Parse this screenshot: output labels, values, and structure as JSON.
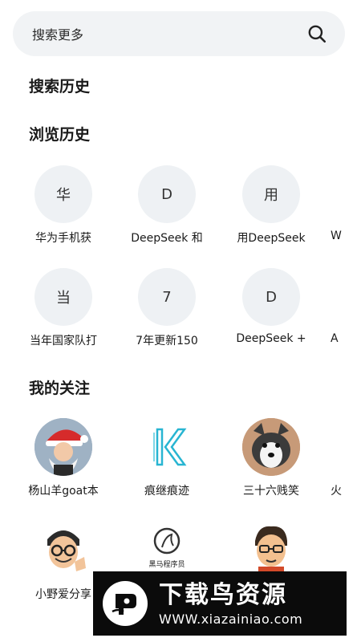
{
  "search": {
    "placeholder": "搜索更多",
    "icon": "search-icon"
  },
  "sections": {
    "history": "搜索历史",
    "browse": "浏览历史",
    "follow": "我的关注"
  },
  "browse_rows": [
    [
      {
        "initial": "华",
        "label": "华为手机获"
      },
      {
        "initial": "D",
        "label": "DeepSeek 和"
      },
      {
        "initial": "用",
        "label": "用DeepSeek"
      },
      {
        "initial": "",
        "label": "W"
      }
    ],
    [
      {
        "initial": "当",
        "label": "当年国家队打"
      },
      {
        "initial": "7",
        "label": "7年更新150"
      },
      {
        "initial": "D",
        "label": "DeepSeek +"
      },
      {
        "initial": "",
        "label": "A"
      }
    ]
  ],
  "follow_rows": [
    [
      {
        "label": "杨山羊goat本",
        "avatar": "santa-avatar"
      },
      {
        "label": "痕继痕迹",
        "avatar": "k-logo-avatar"
      },
      {
        "label": "三十六贱笑",
        "avatar": "husky-avatar"
      },
      {
        "label": "火",
        "avatar": ""
      }
    ],
    [
      {
        "label": "小野爱分享",
        "avatar": "cartoon-glasses-avatar"
      },
      {
        "label": "",
        "avatar": "horse-program-avatar",
        "logo_text": "黑马程序员"
      },
      {
        "label": "",
        "avatar": "cartoon-boy-avatar"
      }
    ]
  ],
  "watermark": {
    "title": "下载鸟资源",
    "url": "WWW.xiazainiao.com"
  },
  "colors": {
    "search_bg": "#f1f3f5",
    "circle_bg": "#eef1f4",
    "accent": "#1ba6c9"
  }
}
